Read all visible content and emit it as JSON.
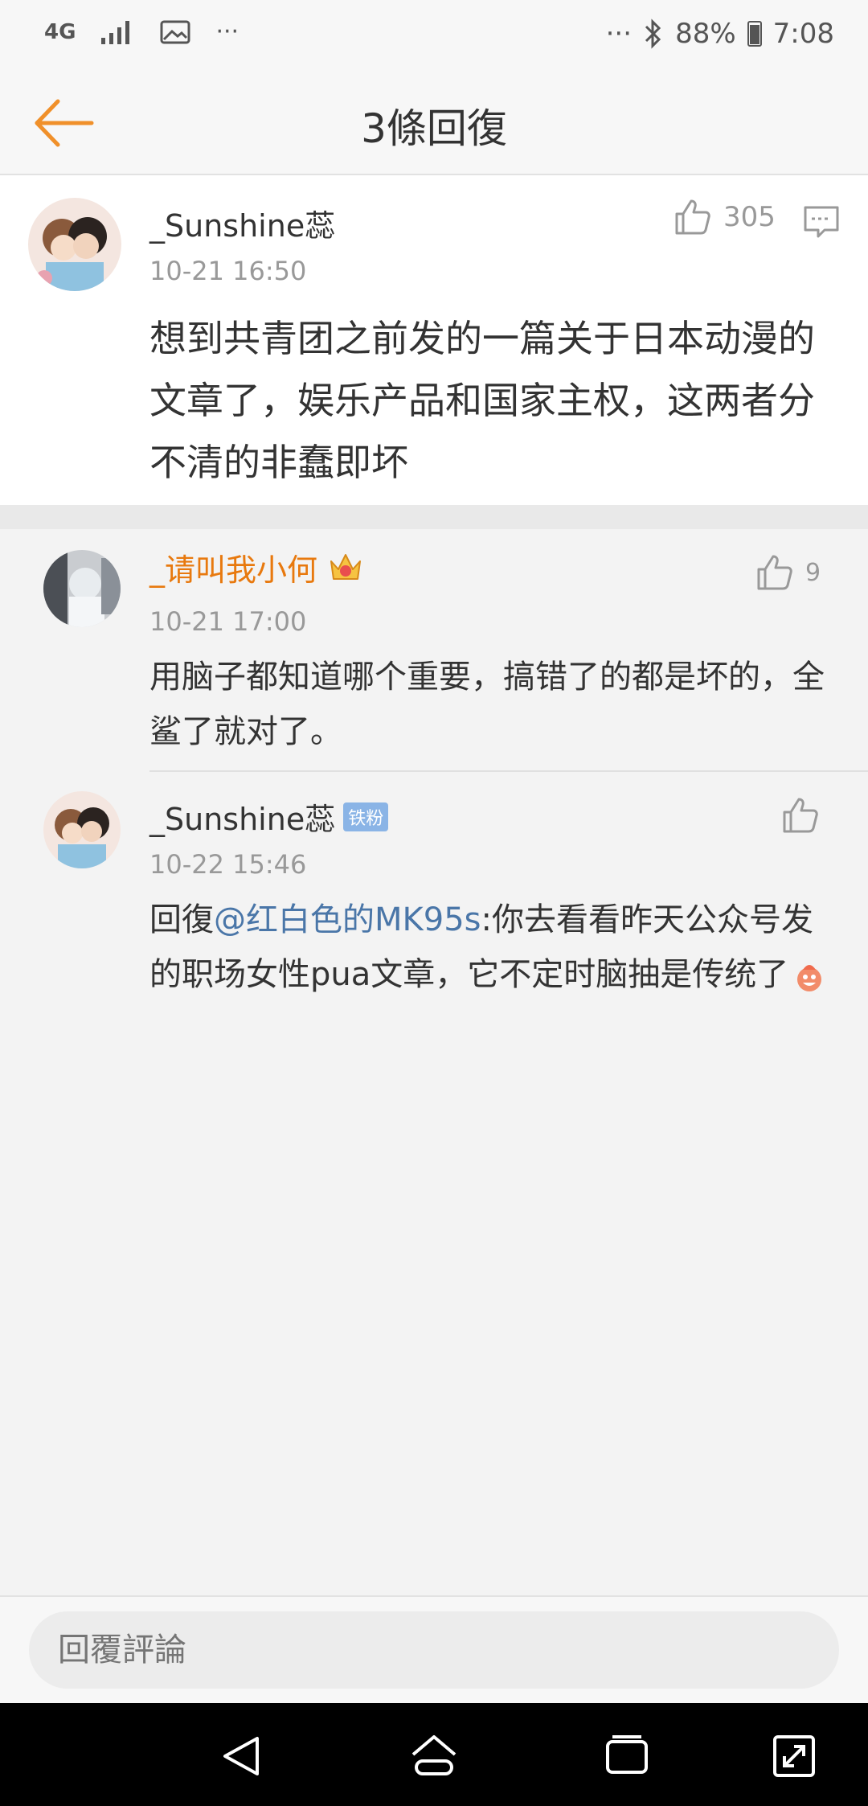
{
  "status": {
    "network": "4G",
    "more_left": "···",
    "more_right": "···",
    "battery": "88%",
    "time": "7:08"
  },
  "nav": {
    "title": "3條回復"
  },
  "main_comment": {
    "username": "_Sunshine蕊",
    "timestamp": "10-21 16:50",
    "likes": "305",
    "text": "想到共青团之前发的一篇关于日本动漫的文章了，娱乐产品和国家主权，这两者分不清的非蠢即坏"
  },
  "replies": [
    {
      "username": "_请叫我小何",
      "timestamp": "10-21 17:00",
      "likes": "9",
      "text": "用脑子都知道哪个重要，搞错了的都是坏的，全鲨了就对了。"
    },
    {
      "username": "_Sunshine蕊",
      "badge": "铁粉",
      "timestamp": "10-22 15:46",
      "prefix": "回復",
      "mention": "@红白色的MK95s",
      "text": ":你去看看昨天公众号发的职场女性pua文章，它不定时脑抽是传统了"
    }
  ],
  "input": {
    "placeholder": "回覆評論"
  },
  "colors": {
    "accent": "#f0902a",
    "vip_name": "#e8790e",
    "mention": "#4a76a8"
  }
}
